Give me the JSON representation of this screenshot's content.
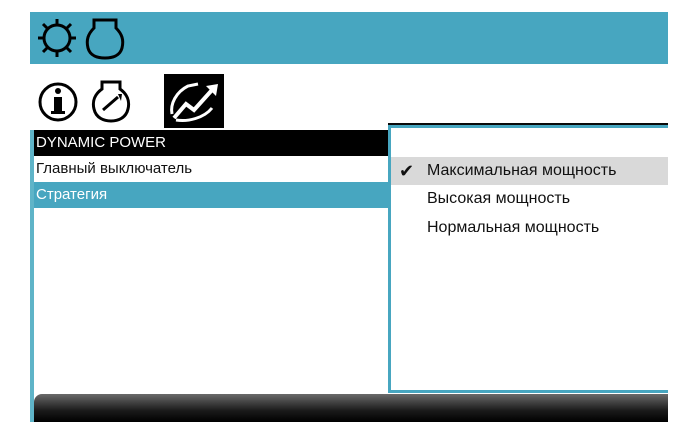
{
  "colors": {
    "accent": "#47a6c0",
    "header_bg": "#000000",
    "selected_bg": "#47a6c0",
    "check_bg": "#d9d9d9"
  },
  "top_icons": [
    "gear-icon",
    "engine-icon"
  ],
  "tabs": [
    {
      "icon": "info-icon",
      "active": false
    },
    {
      "icon": "engine-gauge-icon",
      "active": false
    },
    {
      "icon": "dynamic-power-icon",
      "active": true
    }
  ],
  "list": {
    "header": "DYNAMIC POWER",
    "items": [
      {
        "label": "Главный выключатель",
        "selected": false
      },
      {
        "label": "Стратегия",
        "selected": true
      }
    ]
  },
  "popup": {
    "check_glyph": "✔",
    "options": [
      {
        "label": "Максимальная мощность",
        "checked": true
      },
      {
        "label": "Высокая мощность",
        "checked": false
      },
      {
        "label": "Нормальная мощность",
        "checked": false
      }
    ]
  }
}
